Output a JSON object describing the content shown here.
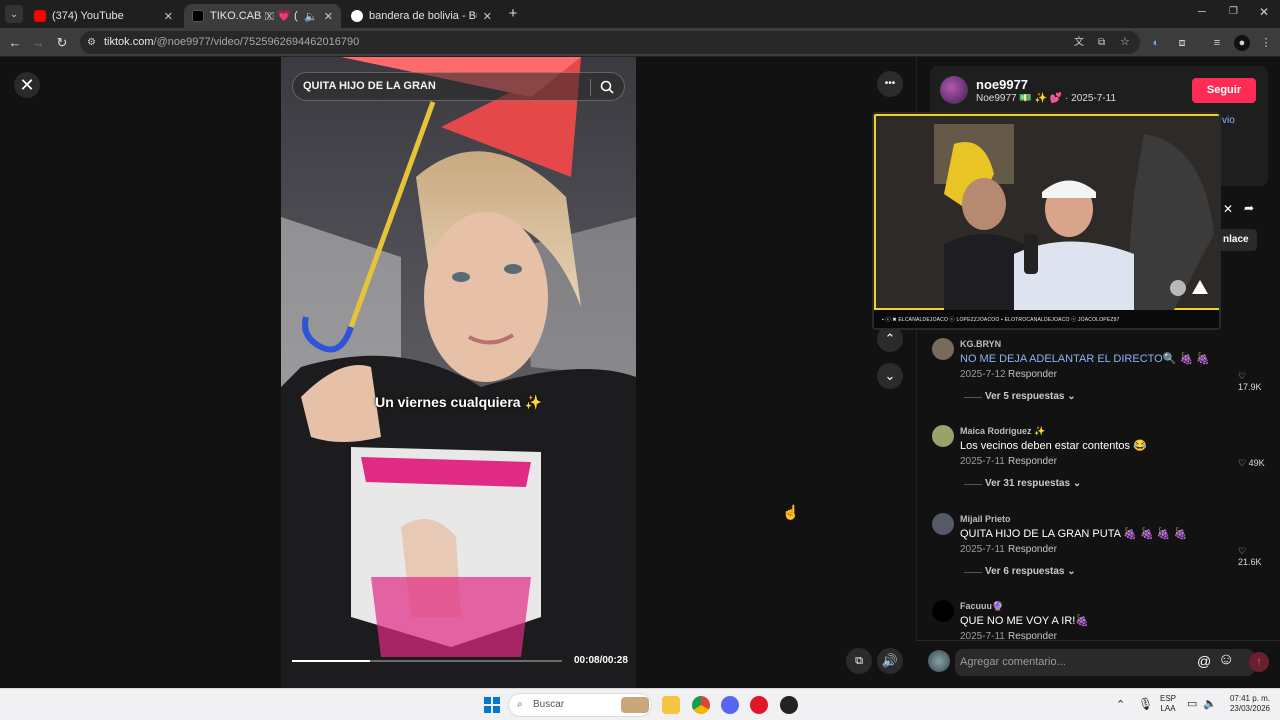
{
  "browser": {
    "tabs": [
      {
        "title": "(374) YouTube",
        "favicon_color": "#ff0000",
        "active": false
      },
      {
        "title": "TIKO.CAB 🇽 💗 (@tiko.cab...",
        "favicon_color": "#000000",
        "active": true
      },
      {
        "title": "bandera de bolivia - Buscar con...",
        "favicon_color": "#4285f4",
        "active": false
      }
    ],
    "new_tab_label": "+",
    "url_domain": "tiktok.com",
    "url_path": "/@noe9977/video/7525962694462016790"
  },
  "player": {
    "close_label": "✕",
    "search_text": "QUITA HIJO DE LA GRAN",
    "caption": "Un viernes cualquiera ✨",
    "time": "00:08/00:28",
    "progress": 0.29,
    "more_label": "•••"
  },
  "author": {
    "username": "noe9977",
    "subline": "Noe9977 💵 ✨ 💕 · 2025-7-11",
    "follow_label": "Seguir",
    "link_label": "nlace",
    "partial_text": "vio"
  },
  "pip": {
    "banner": "▪ ⓒ ✖ ELCANALDEJOACO   ⓒ LOPEZZJOACOO   ▪ ELOTROCANALDEJOACO   ⓒ JOACOLOPEZ97"
  },
  "comments": [
    {
      "user": "KG.BRYN",
      "text": "NO ME DEJA ADELANTAR EL DIRECTO🔍 🍇 🍇",
      "date": "2025-7-12",
      "reply": "Responder",
      "likes": "17.9K",
      "replies": "Ver 5 respuestas",
      "highlight": true,
      "avatar_color": "#7a6a5c"
    },
    {
      "user": "Maica Rodríguez ✨",
      "text": "Los vecinos deben estar contentos 😂",
      "date": "2025-7-11",
      "reply": "Responder",
      "likes": "49K",
      "replies": "Ver 31 respuestas",
      "highlight": false,
      "avatar_color": "#9aa26b"
    },
    {
      "user": "Mijail Prieto",
      "text": "QUITA HIJO DE LA GRAN PUTA 🍇 🍇 🍇 🍇",
      "date": "2025-7-11",
      "reply": "Responder",
      "likes": "21.6K",
      "replies": "Ver 6 respuestas",
      "highlight": false,
      "avatar_color": "#555a66"
    },
    {
      "user": "Facuuu🔮",
      "text": "QUE NO ME VOY A IR!🍇",
      "date": "2025-7-11",
      "reply": "Responder",
      "likes": "",
      "replies": "",
      "highlight": false,
      "avatar_color": "#000000"
    }
  ],
  "comment_input": {
    "placeholder": "Agregar comentario...",
    "at": "@",
    "emoji": "☺"
  },
  "taskbar": {
    "search": "Buscar",
    "lang": "ESP",
    "lang2": "LAA",
    "time": "07:41 p. m.",
    "date": "23/03/2026"
  },
  "colors": {
    "accent": "#fe2c55",
    "link_blue": "#8ab4f8"
  }
}
